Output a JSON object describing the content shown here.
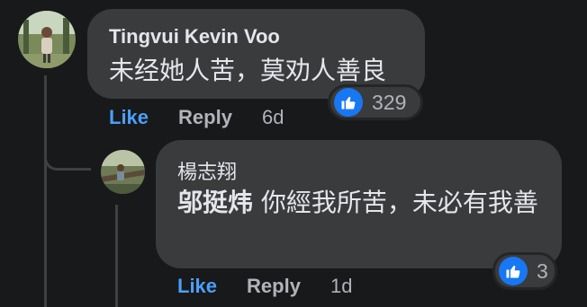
{
  "comments": [
    {
      "author": "Tingvui Kevin Voo",
      "text": "未经她人苦，莫劝人善良",
      "reaction_count": "329",
      "actions": {
        "like": "Like",
        "reply": "Reply",
        "time": "6d"
      }
    },
    {
      "author": "楊志翔",
      "mention": "邬挺炜",
      "text": " 你經我所苦，未必有我善",
      "reaction_count": "3",
      "actions": {
        "like": "Like",
        "reply": "Reply",
        "time": "1d"
      }
    }
  ],
  "colors": {
    "background": "#18191a",
    "bubble": "#3a3b3c",
    "like_blue": "#1877f2",
    "like_text": "#4b9ff8",
    "muted_text": "#b0b3b8"
  },
  "icons": {
    "reaction": "thumbs-up-icon"
  }
}
